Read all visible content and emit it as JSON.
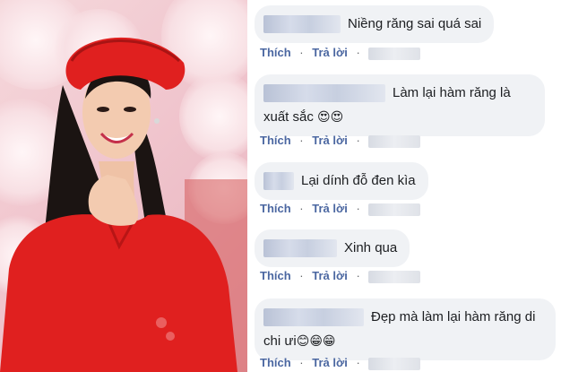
{
  "photo": {
    "icon": "portrait-photo"
  },
  "comments": [
    {
      "text": "Niềng răng sai quá sai",
      "like": "Thích",
      "reply": "Trả lời",
      "emojis": ""
    },
    {
      "text": "Làm lại hàm răng là",
      "text2": "xuất sắc",
      "like": "Thích",
      "reply": "Trả lời",
      "emojis": "😍😍"
    },
    {
      "text": "Lại dính đỗ đen kìa",
      "like": "Thích",
      "reply": "Trả lời",
      "emojis": ""
    },
    {
      "text": "Xinh qua",
      "like": "Thích",
      "reply": "Trả lời",
      "emojis": ""
    },
    {
      "text": "Đẹp mà làm lại hàm răng di",
      "text2": "chi ưi",
      "like": "Thích",
      "reply": "Trả lời",
      "emojis": "😊😁😁"
    }
  ],
  "colors": {
    "bubble": "#f0f2f5",
    "action": "#4b67a1",
    "dress": "#e0201f"
  }
}
